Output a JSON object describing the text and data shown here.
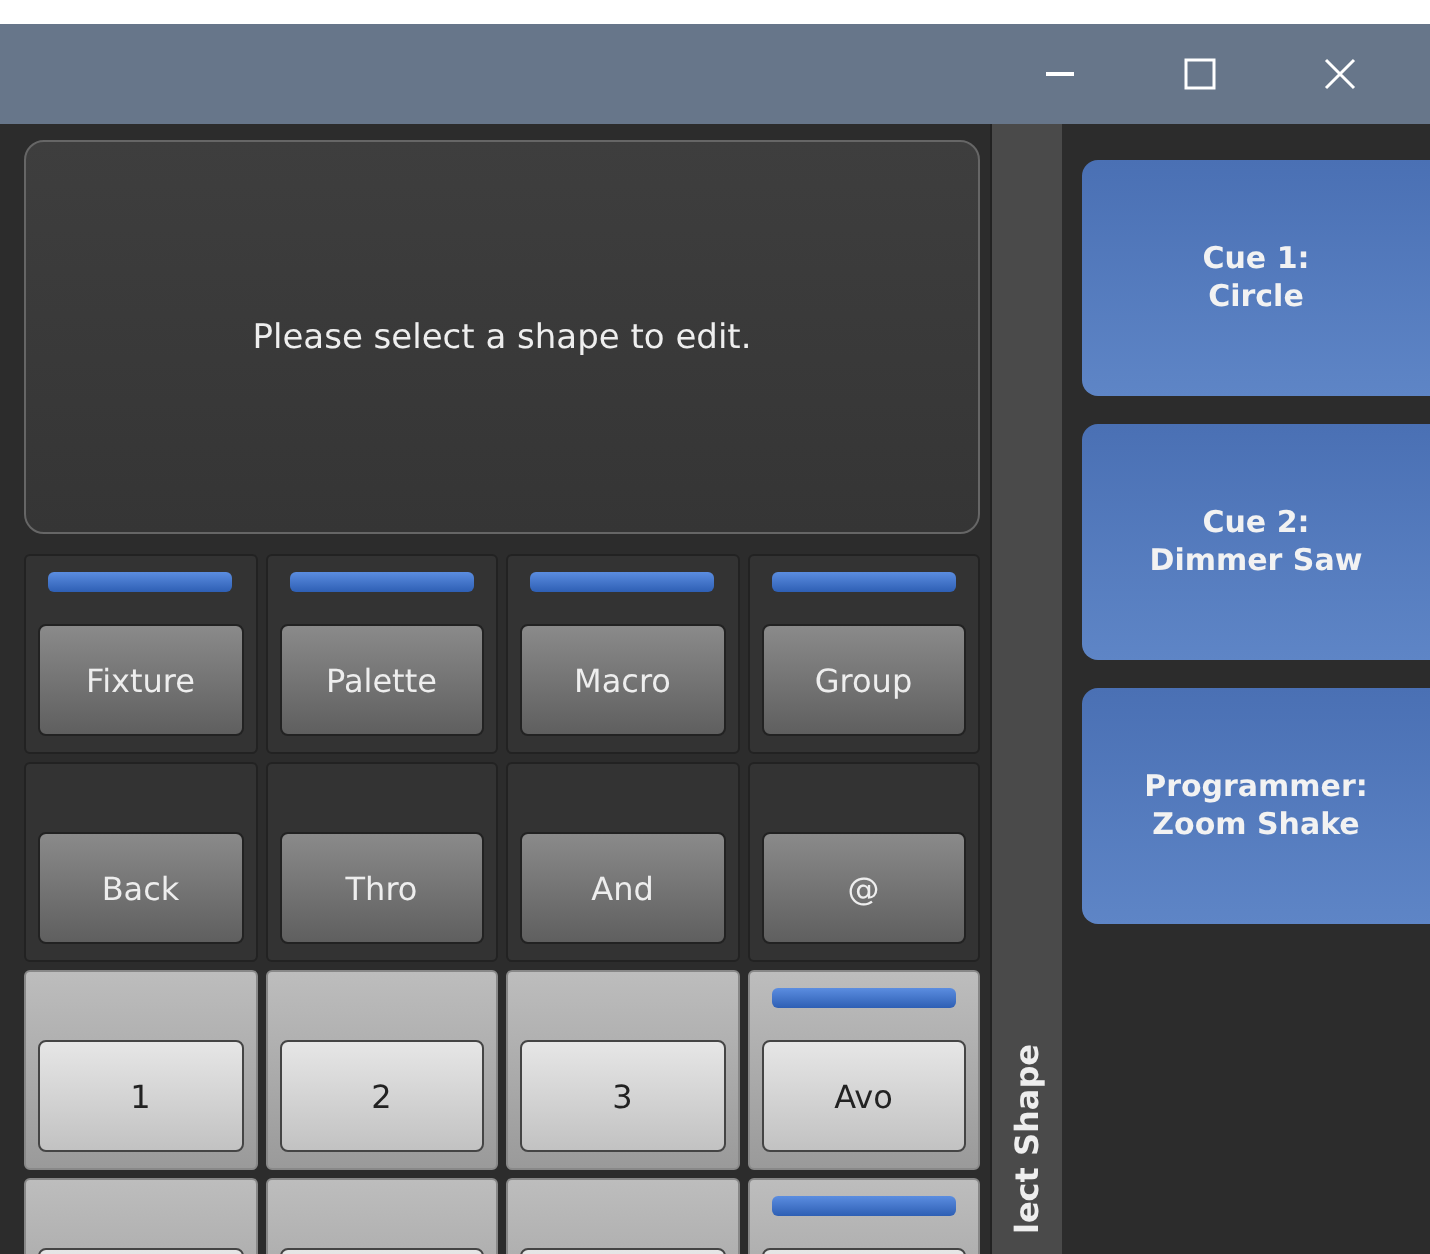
{
  "window": {
    "controls": [
      {
        "kind": "minimize"
      },
      {
        "kind": "maximize"
      },
      {
        "kind": "close"
      }
    ]
  },
  "editor": {
    "message": "Please select a shape to edit."
  },
  "keypad": [
    [
      {
        "label": "Fixture",
        "kind": "dark",
        "led": true
      },
      {
        "label": "Palette",
        "kind": "dark",
        "led": true
      },
      {
        "label": "Macro",
        "kind": "dark",
        "led": true
      },
      {
        "label": "Group",
        "kind": "dark",
        "led": true
      }
    ],
    [
      {
        "label": "Back",
        "kind": "dark",
        "led": false
      },
      {
        "label": "Thro",
        "kind": "dark",
        "led": false
      },
      {
        "label": "And",
        "kind": "dark",
        "led": false
      },
      {
        "label": "@",
        "kind": "dark",
        "led": false
      }
    ],
    [
      {
        "label": "1",
        "kind": "light",
        "led": false
      },
      {
        "label": "2",
        "kind": "light",
        "led": false
      },
      {
        "label": "3",
        "kind": "light",
        "led": false
      },
      {
        "label": "Avo",
        "kind": "light",
        "led": true
      }
    ],
    [
      {
        "kind": "light",
        "led": false
      },
      {
        "kind": "light",
        "led": false
      },
      {
        "kind": "light",
        "led": false
      },
      {
        "kind": "light",
        "led": true
      }
    ]
  ],
  "side_tab": {
    "label": "lect Shape"
  },
  "shapes": [
    {
      "title": "Cue 1:",
      "name": "Circle"
    },
    {
      "title": "Cue 2:",
      "name": "Dimmer Saw"
    },
    {
      "title": "Programmer:",
      "name": "Zoom Shake"
    }
  ]
}
